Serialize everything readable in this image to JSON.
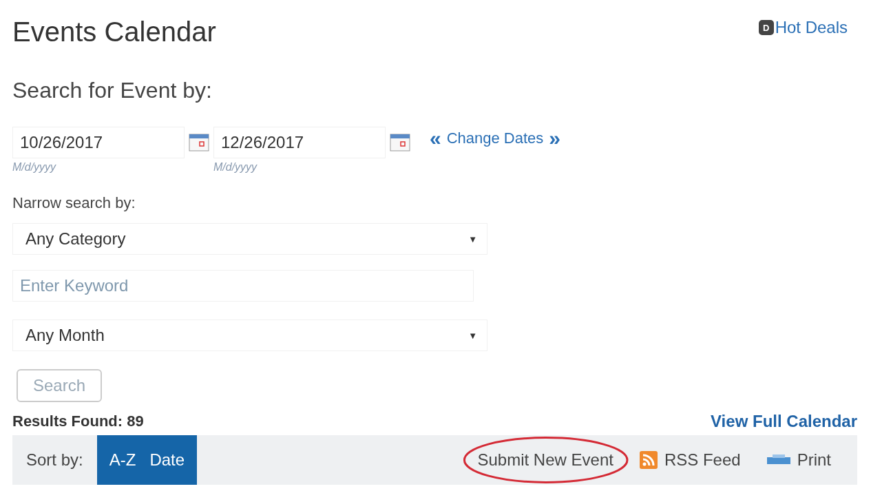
{
  "title": "Events Calendar",
  "hot_deals": {
    "label": "Hot Deals",
    "badge": "D"
  },
  "search_heading": "Search for Event by:",
  "dates": [
    {
      "value": "10/26/2017",
      "hint": "M/d/yyyy"
    },
    {
      "value": "12/26/2017",
      "hint": "M/d/yyyy"
    }
  ],
  "change_dates": {
    "prev": "«",
    "label": "Change Dates",
    "next": "»"
  },
  "narrow_label": "Narrow search by:",
  "category_select": {
    "value": "Any Category",
    "arrow": "▼"
  },
  "keyword": {
    "placeholder": "Enter Keyword"
  },
  "month_select": {
    "value": "Any Month",
    "arrow": "▼"
  },
  "search_button": "Search",
  "results": "Results Found: 89",
  "view_full": "View Full Calendar",
  "sort": {
    "label": "Sort by:",
    "options": [
      {
        "label": "A-Z",
        "selected": false
      },
      {
        "label": "Date",
        "selected": false
      }
    ]
  },
  "actions": [
    {
      "kind": "submit",
      "label": "Submit New Event",
      "circled": true
    },
    {
      "kind": "rss",
      "label": "RSS Feed",
      "circled": false
    },
    {
      "kind": "print",
      "label": "Print",
      "circled": false
    }
  ]
}
